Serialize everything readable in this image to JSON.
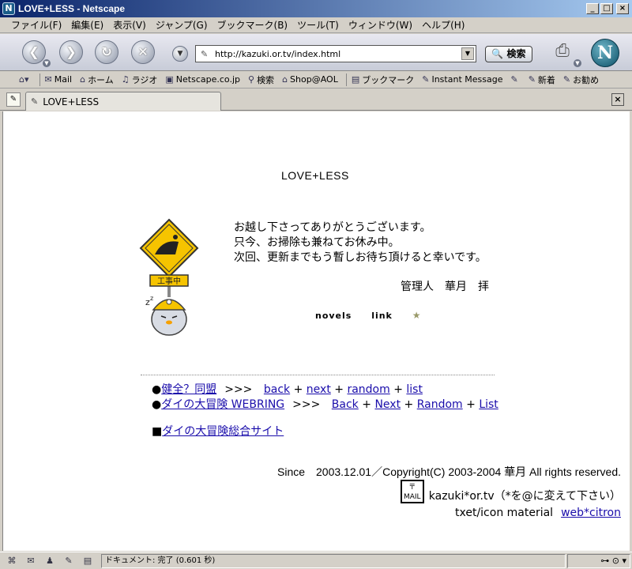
{
  "window": {
    "title": "LOVE+LESS - Netscape"
  },
  "menu": [
    "ファイル(F)",
    "編集(E)",
    "表示(V)",
    "ジャンプ(G)",
    "ブックマーク(B)",
    "ツール(T)",
    "ウィンドウ(W)",
    "ヘルプ(H)"
  ],
  "navbar": {
    "url": "http://kazuki.or.tv/index.html",
    "search_label": "検索",
    "logo_letter": "N"
  },
  "personal_toolbar": [
    "Mail",
    "ホーム",
    "ラジオ",
    "Netscape.co.jp",
    "検索",
    "Shop@AOL",
    "ブックマーク",
    "Instant Message",
    "新着",
    "お勧め"
  ],
  "tab": {
    "label": "LOVE+LESS"
  },
  "page": {
    "title": "LOVE+LESS",
    "sign_text": "工事中",
    "message_lines": [
      "お越し下さってありがとうございます。",
      "只今、お掃除も兼ねてお休み中。",
      "次回、更新までもう暫しお待ち頂けると幸いです。"
    ],
    "signature": "管理人　華月　拝",
    "nav_links": [
      "novels",
      "link"
    ],
    "nav_star": "★",
    "ring1": {
      "bullet": "●",
      "name": "健全？同盟",
      "arrow": ">>>",
      "links": [
        "back",
        "next",
        "random",
        "list"
      ],
      "joiner": "+"
    },
    "ring2": {
      "bullet": "●",
      "name": "ダイの大冒険 WEBRING",
      "arrow": ">>>",
      "links": [
        "Back",
        "Next",
        "Random",
        "List"
      ],
      "joiner": "+"
    },
    "site": {
      "bullet": "■",
      "name": "ダイの大冒険総合サイト"
    },
    "copyright": "Since　2003.12.01／Copyright(C) 2003-2004 華月 All rights reserved.",
    "mail_icon_text": "MAIL",
    "mail": "kazuki*or.tv（*を@に変えて下さい）",
    "credit_label": "txet/icon material",
    "credit_link": "web*citron"
  },
  "status": {
    "text": "ドキュメント: 完了 (0.601 秒)"
  }
}
